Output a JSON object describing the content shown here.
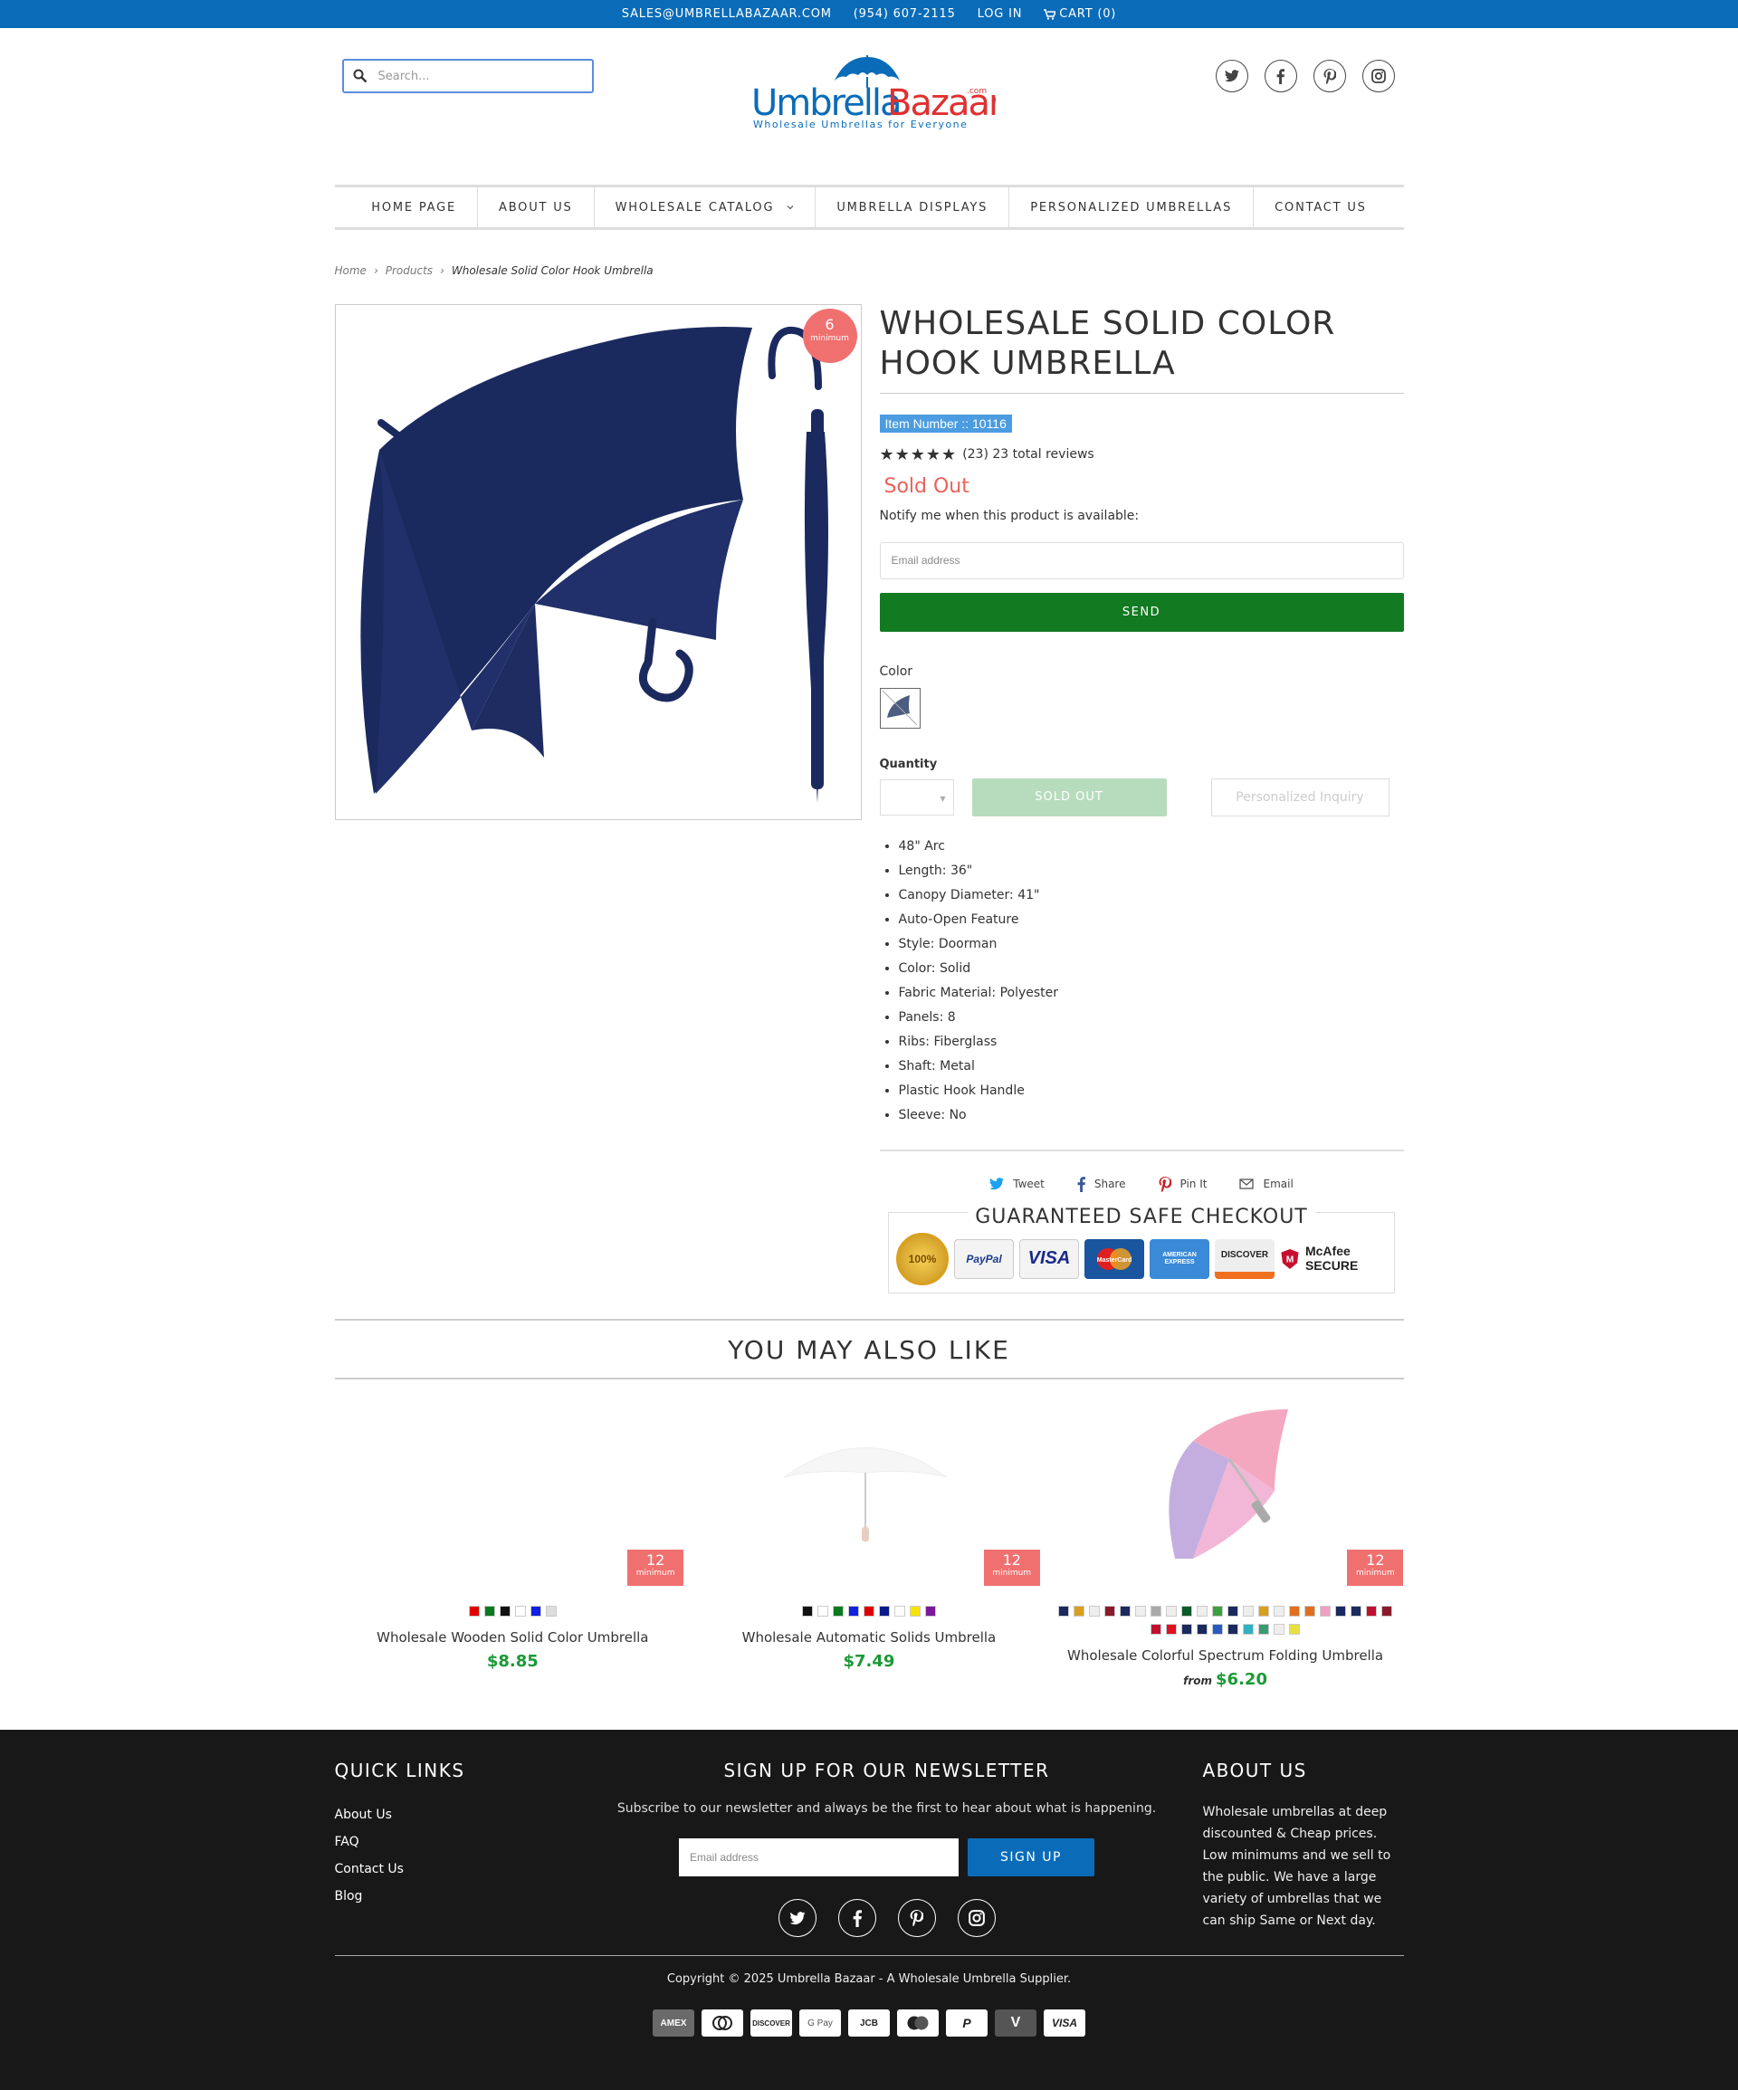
{
  "topbar": {
    "email": "SALES@UMBRELLABAZAAR.COM",
    "phone": "(954) 607-2115",
    "login": "LOG IN",
    "cart": "CART (0)"
  },
  "search": {
    "placeholder": "Search..."
  },
  "logo": {
    "name": "UmbrellaBazaar",
    "suffix": ".com",
    "tagline": "Wholesale Umbrellas for Everyone"
  },
  "nav": {
    "items": [
      "HOME PAGE",
      "ABOUT US",
      "WHOLESALE CATALOG",
      "UMBRELLA DISPLAYS",
      "PERSONALIZED UMBRELLAS",
      "CONTACT US"
    ]
  },
  "breadcrumb": {
    "home": "Home",
    "products": "Products",
    "current": "Wholesale Solid Color Hook Umbrella"
  },
  "product": {
    "title": "WHOLESALE SOLID COLOR HOOK UMBRELLA",
    "badge_number": "6",
    "badge_label": "minimum",
    "item_number": "Item Number :: 10116",
    "rating_text": "(23) 23 total reviews",
    "stars": 5,
    "sold_out": "Sold Out",
    "notify": "Notify me when this product is available:",
    "email_placeholder": "Email address",
    "send": "SEND",
    "color_label": "Color",
    "quantity_label": "Quantity",
    "sold_out_button": "SOLD OUT",
    "inquiry_button": "Personalized Inquiry",
    "image_color": "#1b2a5e",
    "features": [
      "48\" Arc",
      "Length: 36\"",
      "Canopy Diameter: 41\"",
      "Auto-Open Feature",
      "Style: Doorman",
      "Color: Solid",
      "Fabric Material: Polyester",
      "Panels: 8",
      "Ribs: Fiberglass",
      "Shaft: Metal",
      "Plastic Hook Handle",
      "Sleeve: No"
    ]
  },
  "share": {
    "tweet": "Tweet",
    "share": "Share",
    "pin": "Pin It",
    "email": "Email"
  },
  "checkout": {
    "caption": "GUARANTEED SAFE CHECKOUT",
    "seal": "100%",
    "cards": [
      "PayPal",
      "VISA",
      "MasterCard",
      "AMERICAN EXPRESS",
      "DISCOVER",
      "McAfee SECURE"
    ]
  },
  "also": {
    "title": "YOU MAY ALSO LIKE",
    "products": [
      {
        "name": "Wholesale Wooden Solid Color Umbrella",
        "price": "$8.85",
        "from": "",
        "badge_number": "12",
        "badge_label": "minimum",
        "swatches": [
          "#e00000",
          "#0a7a1e",
          "#111111",
          "#ffffff",
          "#1020e0",
          "#dddddd"
        ]
      },
      {
        "name": "Wholesale Automatic Solids Umbrella",
        "price": "$7.49",
        "from": "",
        "badge_number": "12",
        "badge_label": "minimum",
        "swatches": [
          "#111111",
          "#ffffff",
          "#0a7a1e",
          "#1020e0",
          "#e00000",
          "#0a1a8a",
          "#ffffff",
          "#f4e400",
          "#7a1a9a"
        ]
      },
      {
        "name": "Wholesale Colorful Spectrum Folding Umbrella",
        "price": "$6.20",
        "from": "from",
        "badge_number": "12",
        "badge_label": "minimum",
        "swatches": [
          "#1b2a5e",
          "#d9a020",
          "#eee",
          "#8a1a2a",
          "#1b2a5e",
          "#eee",
          "#aaa",
          "#eee",
          "#0a5a2a",
          "#eee",
          "#3aa040",
          "#1b2a5e",
          "#eee",
          "#d9a020",
          "#eee",
          "#e07020",
          "#e07020",
          "#f0a0c0",
          "#1b2a5e",
          "#1b2a5e",
          "#c01030",
          "#8a1a2a",
          "#c01030",
          "#e01020",
          "#1b2a5e",
          "#1b2a5e",
          "#2a5ac0",
          "#1b2a5e",
          "#30b0c0",
          "#3a9a70",
          "#eee",
          "#e8e040"
        ]
      }
    ]
  },
  "footer": {
    "quick_links_title": "QUICK LINKS",
    "quick_links": [
      "About Us",
      "FAQ",
      "Contact Us",
      "Blog"
    ],
    "newsletter_title": "SIGN UP FOR OUR NEWSLETTER",
    "newsletter_text": "Subscribe to our newsletter and always be the first to hear about what is happening.",
    "newsletter_placeholder": "Email address",
    "signup": "SIGN UP",
    "about_title": "ABOUT US",
    "about_text": "Wholesale umbrellas at deep discounted & Cheap prices. Low minimums and we sell to the public. We have a large variety of umbrellas that we can ship Same or Next day.",
    "copyright": "Copyright © 2025 Umbrella Bazaar - A Wholesale Umbrella Supplier.",
    "payment_icons": [
      "AMEX",
      "Diners",
      "DISCOVER",
      "G Pay",
      "JCB",
      "Master",
      "PayPal",
      "Venmo",
      "VISA"
    ]
  }
}
